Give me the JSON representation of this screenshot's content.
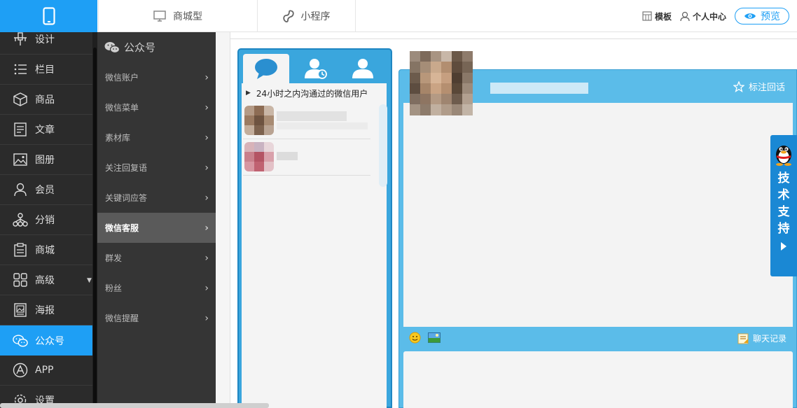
{
  "topbar": {
    "tabs": [
      {
        "label": "商城型",
        "icon": "monitor-icon"
      },
      {
        "label": "小程序",
        "icon": "mini-program-icon"
      }
    ],
    "template_label": "模板",
    "user_center_label": "个人中心",
    "preview_label": "预览"
  },
  "sidebar": {
    "items": [
      {
        "label": "设计",
        "icon": "design-icon"
      },
      {
        "label": "栏目",
        "icon": "list-icon"
      },
      {
        "label": "商品",
        "icon": "box-icon"
      },
      {
        "label": "文章",
        "icon": "document-icon"
      },
      {
        "label": "图册",
        "icon": "image-icon"
      },
      {
        "label": "会员",
        "icon": "user-icon"
      },
      {
        "label": "分销",
        "icon": "network-icon"
      },
      {
        "label": "商城",
        "icon": "clipboard-icon"
      },
      {
        "label": "高级",
        "icon": "grid-icon"
      },
      {
        "label": "海报",
        "icon": "poster-icon"
      },
      {
        "label": "公众号",
        "icon": "wechat-icon",
        "active": true
      },
      {
        "label": "APP",
        "icon": "app-icon"
      },
      {
        "label": "设置",
        "icon": "gear-icon"
      }
    ]
  },
  "subnav": {
    "title": "公众号",
    "items": [
      {
        "label": "微信账户"
      },
      {
        "label": "微信菜单"
      },
      {
        "label": "素材库"
      },
      {
        "label": "关注回复语"
      },
      {
        "label": "关键词应答"
      },
      {
        "label": "微信客服",
        "active": true
      },
      {
        "label": "群发"
      },
      {
        "label": "粉丝"
      },
      {
        "label": "微信提醒"
      }
    ]
  },
  "chat_list": {
    "section_title": "24小时之内沟通过的微信用户"
  },
  "chat_panel": {
    "star_label": "标注回话",
    "history_label": "聊天记录"
  },
  "support": {
    "label": "技术支持"
  },
  "colors": {
    "accent": "#1e9ff5",
    "sidebar_bg": "#2b2b2b",
    "subnav_bg": "#353535",
    "panel_blue": "#5bbce9",
    "support_blue": "#1a88d4"
  }
}
